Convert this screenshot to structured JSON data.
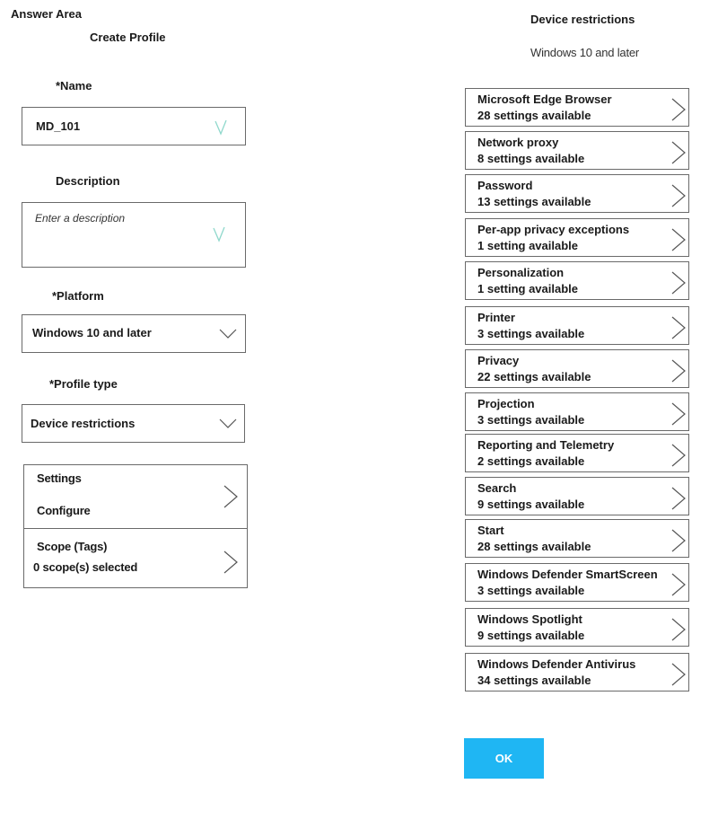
{
  "header": {
    "answer_area": "Answer Area"
  },
  "left_panel": {
    "title": "Create Profile",
    "name": {
      "label": "*Name",
      "value": "MD_101",
      "validated": true
    },
    "description": {
      "label": "Description",
      "placeholder": "Enter a description",
      "validated": true
    },
    "platform": {
      "label": "*Platform",
      "selected": "Windows 10 and later"
    },
    "profile_type": {
      "label": "*Profile type",
      "selected": "Device restrictions"
    },
    "settings": {
      "title": "Settings",
      "subtitle": "Configure"
    },
    "scope": {
      "title": "Scope (Tags)",
      "subtitle": "0 scope(s) selected"
    }
  },
  "right_panel": {
    "title": "Device restrictions",
    "subtitle": "Windows 10 and later",
    "items": [
      {
        "name": "Microsoft Edge Browser",
        "count": "28 settings available"
      },
      {
        "name": "Network proxy",
        "count": "8 settings available"
      },
      {
        "name": "Password",
        "count": "13 settings available"
      },
      {
        "name": "Per-app privacy exceptions",
        "count": "1 setting available"
      },
      {
        "name": "Personalization",
        "count": "1 setting available"
      },
      {
        "name": "Printer",
        "count": "3 settings available"
      },
      {
        "name": "Privacy",
        "count": "22 settings available"
      },
      {
        "name": "Projection",
        "count": "3 settings available"
      },
      {
        "name": "Reporting and Telemetry",
        "count": "2 settings available"
      },
      {
        "name": "Search",
        "count": "9 settings available"
      },
      {
        "name": "Start",
        "count": "28 settings available"
      },
      {
        "name": "Windows Defender SmartScreen",
        "count": "3 settings available"
      },
      {
        "name": "Windows Spotlight",
        "count": "9 settings available"
      },
      {
        "name": "Windows Defender Antivirus",
        "count": "34 settings available"
      }
    ],
    "ok_label": "OK"
  },
  "colors": {
    "accent": "#1fb6f3",
    "check": "#8fd8cc",
    "border": "#6a6a6a"
  }
}
